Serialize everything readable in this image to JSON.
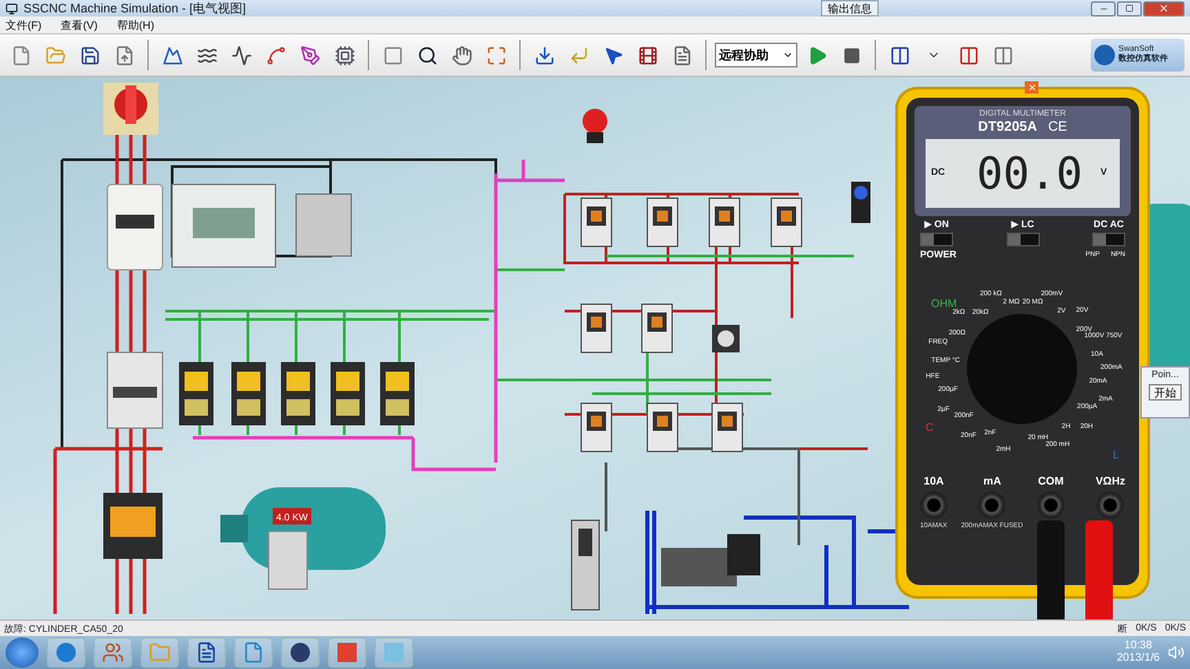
{
  "window": {
    "title": "SSCNC Machine Simulation - [电气视图]",
    "floating_tab": "输出信息"
  },
  "menu": [
    "文件(F)",
    "查看(V)",
    "帮助(H)"
  ],
  "toolbar": {
    "dropdown": "远程协助",
    "logo": {
      "brand": "SwanSoft",
      "subtitle": "数控仿真软件"
    }
  },
  "canvas": {
    "motor": {
      "rating": "4.0 KW"
    },
    "multimeter": {
      "header": "DIGITAL MULTIMETER",
      "model": "DT9205A",
      "mark": "CE",
      "mode": "DC",
      "reading": "00.0",
      "unit": "V",
      "switches": [
        {
          "label": "▶ ON",
          "on": false
        },
        {
          "label": "▶ LC",
          "on": false
        },
        {
          "label": "DC  AC",
          "on": false
        }
      ],
      "power": "POWER",
      "transistor": [
        "PNP",
        "NPN"
      ],
      "sections": [
        {
          "label": "OHM",
          "color": "#3db34a"
        },
        {
          "label": "C",
          "color": "#e03030"
        },
        {
          "label": "L",
          "color": "#3a6fd0"
        }
      ],
      "dial_labels_left": [
        "2 MΩ",
        "200 kΩ",
        "20kΩ",
        "2kΩ",
        "200Ω",
        "FREQ",
        "TEMP °C",
        "HFE",
        "200µF",
        "2µF",
        "200nF",
        "20nF",
        "2nF",
        "2mH"
      ],
      "dial_labels_right": [
        "20 MΩ",
        "200mV",
        "2V",
        "20V",
        "200V",
        "1000V 750V",
        "10A",
        "200mA",
        "20mA",
        "2mA",
        "200µA",
        "20H",
        "2H",
        "200 mH",
        "20 mH"
      ],
      "jacks": [
        "10A",
        "mA",
        "COM",
        "VΩHz"
      ],
      "fuse_notes": [
        "10AMAX",
        "200mAMAX FUSED"
      ]
    },
    "dialog": {
      "title": "Poin...",
      "button": "开始"
    }
  },
  "status_bar": {
    "fault": "故障: CYLINDER_CA50_20",
    "indicator": "断",
    "download": "0K/S",
    "upload": "0K/S"
  },
  "taskbar": {
    "time": "10:38",
    "date": "2013/1/6"
  }
}
